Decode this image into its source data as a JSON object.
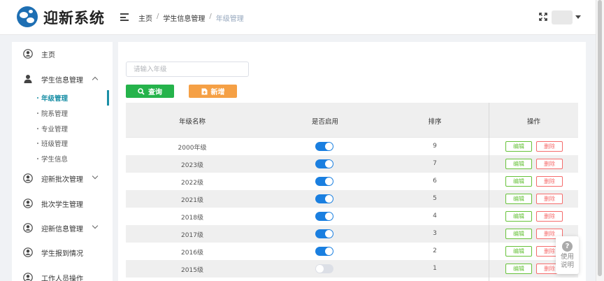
{
  "app": {
    "title": "迎新系统"
  },
  "breadcrumb": [
    {
      "label": "主页"
    },
    {
      "label": "学生信息管理"
    },
    {
      "label": "年级管理"
    }
  ],
  "breadcrumb_sep": "/",
  "sidebar": {
    "items": [
      {
        "label": "主页",
        "icon": "user-circle-icon"
      },
      {
        "label": "学生信息管理",
        "icon": "user-icon",
        "expanded": true
      },
      {
        "label": "年级管理",
        "sub": true,
        "active": true
      },
      {
        "label": "院系管理",
        "sub": true
      },
      {
        "label": "专业管理",
        "sub": true
      },
      {
        "label": "班级管理",
        "sub": true
      },
      {
        "label": "学生信息",
        "sub": true
      },
      {
        "label": "迎新批次管理",
        "icon": "user-circle-icon",
        "expandable": true
      },
      {
        "label": "批次学生管理",
        "icon": "user-circle-icon"
      },
      {
        "label": "迎新信息管理",
        "icon": "user-circle-icon",
        "expandable": true
      },
      {
        "label": "学生报到情况",
        "icon": "user-circle-icon"
      },
      {
        "label": "工作人员操作",
        "icon": "user-circle-icon"
      }
    ]
  },
  "search": {
    "placeholder": "请输入年级",
    "value": ""
  },
  "buttons": {
    "query": "查询",
    "add": "新增"
  },
  "table": {
    "headers": [
      "年级名称",
      "是否启用",
      "排序",
      "操作"
    ],
    "rows": [
      {
        "name": "2000年级",
        "enabled": true,
        "sort": "9"
      },
      {
        "name": "2023级",
        "enabled": true,
        "sort": "7"
      },
      {
        "name": "2022级",
        "enabled": true,
        "sort": "6"
      },
      {
        "name": "2021级",
        "enabled": true,
        "sort": "5"
      },
      {
        "name": "2018级",
        "enabled": true,
        "sort": "4"
      },
      {
        "name": "2017级",
        "enabled": true,
        "sort": "3"
      },
      {
        "name": "2016级",
        "enabled": true,
        "sort": "2"
      },
      {
        "name": "2015级",
        "enabled": false,
        "sort": "1"
      }
    ],
    "actions": {
      "edit": "编辑",
      "delete": "删除"
    }
  },
  "help": {
    "text": "使用说明"
  },
  "colors": {
    "accent": "#1a8fa6",
    "query_btn": "#25b34b",
    "add_btn": "#f5a045",
    "switch_on": "#1a7fe0",
    "edit": "#67c23a",
    "delete": "#f56c6c"
  }
}
